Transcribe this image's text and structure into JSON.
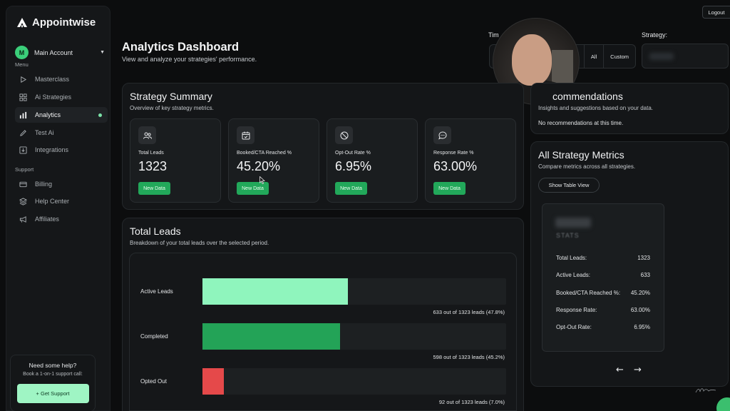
{
  "brand": {
    "name": "Appointwise"
  },
  "account": {
    "initial": "M",
    "name": "Main Account"
  },
  "sidebar": {
    "menu_label": "Menu",
    "support_label": "Support",
    "menu_items": [
      {
        "label": "Masterclass",
        "icon": "play-icon"
      },
      {
        "label": "Ai Strategies",
        "icon": "grid-icon"
      },
      {
        "label": "Analytics",
        "icon": "bar-chart-icon",
        "active": true
      },
      {
        "label": "Test Ai",
        "icon": "pencil-icon"
      },
      {
        "label": "Integrations",
        "icon": "download-icon"
      }
    ],
    "support_items": [
      {
        "label": "Billing",
        "icon": "credit-card-icon"
      },
      {
        "label": "Help Center",
        "icon": "layers-icon"
      },
      {
        "label": "Affiliates",
        "icon": "megaphone-icon"
      }
    ],
    "help": {
      "title": "Need some help?",
      "subtitle": "Book a 1-on-1 support call:",
      "button": "+ Get Support"
    }
  },
  "header": {
    "title": "Analytics Dashboard",
    "subtitle": "View and analyze your strategies' performance.",
    "logout": "Logout",
    "time_label": "Tim",
    "time_options": [
      "All",
      "Custom"
    ],
    "strategy_label": "Strategy:"
  },
  "summary": {
    "title": "Strategy Summary",
    "subtitle": "Overview of key strategy metrics.",
    "new_data_label": "New Data",
    "metrics": [
      {
        "label": "Total Leads",
        "value": "1323",
        "icon": "users-icon"
      },
      {
        "label": "Booked/CTA Reached %",
        "value": "45.20%",
        "icon": "calendar-check-icon"
      },
      {
        "label": "Opt-Out Rate %",
        "value": "6.95%",
        "icon": "ban-icon"
      },
      {
        "label": "Response Rate %",
        "value": "63.00%",
        "icon": "chat-icon"
      }
    ]
  },
  "total_leads": {
    "title": "Total Leads",
    "subtitle": "Breakdown of your total leads over the selected period.",
    "bars": [
      {
        "label": "Active Leads",
        "fraction": 0.478,
        "color": "#8ff5bd",
        "caption": "633 out of 1323 leads (47.8%)"
      },
      {
        "label": "Completed",
        "fraction": 0.452,
        "color": "#23a357",
        "caption": "598 out of 1323 leads (45.2%)"
      },
      {
        "label": "Opted Out",
        "fraction": 0.07,
        "color": "#e5494a",
        "caption": "92 out of 1323 leads (7.0%)"
      }
    ]
  },
  "recommendations": {
    "title": "commendations",
    "subtitle": "Insights and suggestions based on your data.",
    "empty": "No recommendations at this time."
  },
  "all_metrics": {
    "title": "All Strategy Metrics",
    "subtitle": "Compare metrics across all strategies.",
    "table_button": "Show Table View",
    "stats_label": "STATS",
    "rows": [
      {
        "label": "Total Leads:",
        "value": "1323"
      },
      {
        "label": "Active Leads:",
        "value": "633"
      },
      {
        "label": "Booked/CTA Reached %:",
        "value": "45.20%"
      },
      {
        "label": "Response Rate:",
        "value": "63.00%"
      },
      {
        "label": "Opt-Out Rate:",
        "value": "6.95%"
      }
    ],
    "prev": "←",
    "next": "→"
  }
}
